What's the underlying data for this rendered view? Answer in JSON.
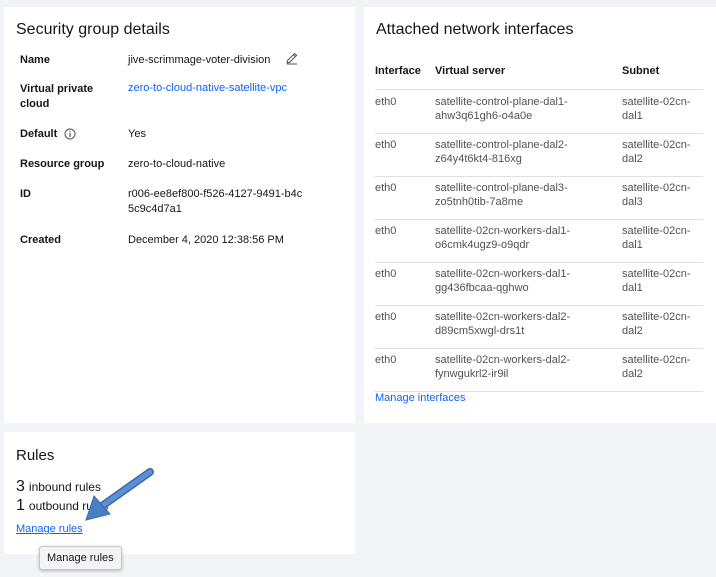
{
  "details": {
    "title": "Security group details",
    "name_label": "Name",
    "name_value": "jive-scrimmage-voter-division",
    "vpc_label": "Virtual private cloud",
    "vpc_value": "zero-to-cloud-native-satellite-vpc",
    "default_label": "Default",
    "default_value": "Yes",
    "rg_label": "Resource group",
    "rg_value": "zero-to-cloud-native",
    "id_label": "ID",
    "id_value": "r006-ee8ef800-f526-4127-9491-b4c5c9c4d7a1",
    "created_label": "Created",
    "created_value": "December 4, 2020 12:38:56 PM",
    "icons": [
      "edit-icon",
      "info-icon"
    ]
  },
  "attached": {
    "title": "Attached network interfaces",
    "columns": [
      "Interface",
      "Virtual server",
      "Subnet"
    ],
    "rows": [
      {
        "iface": "eth0",
        "server": "satellite-control-plane-dal1-ahw3q61gh6-o4a0e",
        "subnet": "satellite-02cn-dal1"
      },
      {
        "iface": "eth0",
        "server": "satellite-control-plane-dal2-z64y4t6kt4-816xg",
        "subnet": "satellite-02cn-dal2"
      },
      {
        "iface": "eth0",
        "server": "satellite-control-plane-dal3-zo5tnh0tib-7a8me",
        "subnet": "satellite-02cn-dal3"
      },
      {
        "iface": "eth0",
        "server": "satellite-02cn-workers-dal1-o6cmk4ugz9-o9qdr",
        "subnet": "satellite-02cn-dal1"
      },
      {
        "iface": "eth0",
        "server": "satellite-02cn-workers-dal1-gg436fbcaa-qghwo",
        "subnet": "satellite-02cn-dal1"
      },
      {
        "iface": "eth0",
        "server": "satellite-02cn-workers-dal2-d89cm5xwgl-drs1t",
        "subnet": "satellite-02cn-dal2"
      },
      {
        "iface": "eth0",
        "server": "satellite-02cn-workers-dal2-fynwgukrl2-ir9il",
        "subnet": "satellite-02cn-dal2"
      }
    ],
    "manage_label": "Manage interfaces"
  },
  "rules": {
    "title": "Rules",
    "inbound_count": "3",
    "inbound_label": "inbound rules",
    "outbound_count": "1",
    "outbound_label": "outbound rules",
    "manage_label": "Manage rules",
    "tooltip": "Manage rules"
  },
  "colors": {
    "link": "#0f62fe",
    "background": "#f2f4f8",
    "arrow": "#4a7fc1"
  }
}
